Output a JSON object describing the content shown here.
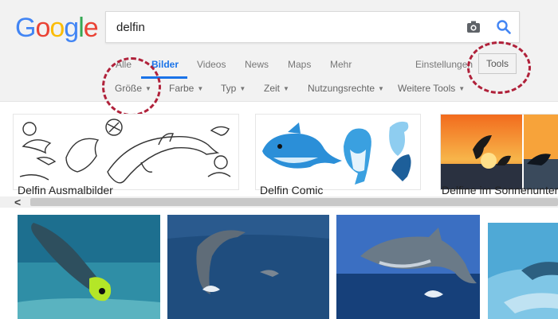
{
  "logo": {
    "letters": [
      "G",
      "o",
      "o",
      "g",
      "l",
      "e"
    ],
    "colors": [
      "#4285F4",
      "#EA4335",
      "#FBBC05",
      "#4285F4",
      "#34A853",
      "#EA4335"
    ]
  },
  "search": {
    "value": "delfin",
    "camera_icon": "camera-icon",
    "search_icon": "magnifier-icon"
  },
  "tabs": [
    {
      "label": "Alle",
      "active": false
    },
    {
      "label": "Bilder",
      "active": true
    },
    {
      "label": "Videos",
      "active": false
    },
    {
      "label": "News",
      "active": false
    },
    {
      "label": "Maps",
      "active": false
    },
    {
      "label": "Mehr",
      "active": false
    }
  ],
  "settings_label": "Einstellungen",
  "tools_label": "Tools",
  "tool_filters": [
    {
      "label": "Größe"
    },
    {
      "label": "Farbe"
    },
    {
      "label": "Typ"
    },
    {
      "label": "Zeit"
    },
    {
      "label": "Nutzungsrechte"
    },
    {
      "label": "Weitere Tools"
    }
  ],
  "suggestions": [
    {
      "label": "Delfin Ausmalbilder"
    },
    {
      "label": "Delfin Comic"
    },
    {
      "label": "Delfine im Sonnenuntergang"
    }
  ],
  "colors": {
    "accent": "#1a73e8",
    "annotation": "#b0213a",
    "header_bg": "#f2f2f2"
  }
}
